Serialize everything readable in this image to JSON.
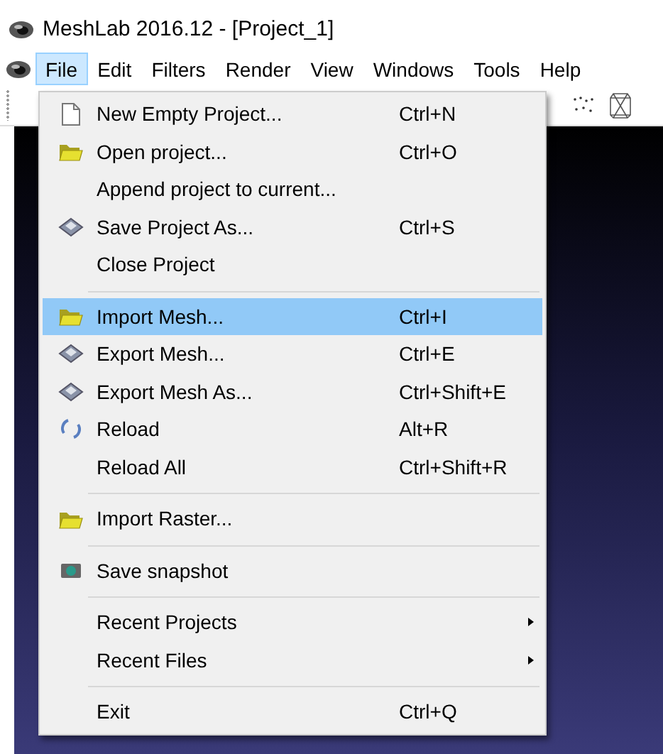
{
  "window": {
    "title": "MeshLab 2016.12 - [Project_1]"
  },
  "menubar": [
    {
      "label": "File",
      "selected": true
    },
    {
      "label": "Edit",
      "selected": false
    },
    {
      "label": "Filters",
      "selected": false
    },
    {
      "label": "Render",
      "selected": false
    },
    {
      "label": "View",
      "selected": false
    },
    {
      "label": "Windows",
      "selected": false
    },
    {
      "label": "Tools",
      "selected": false
    },
    {
      "label": "Help",
      "selected": false
    }
  ],
  "file_menu": [
    {
      "kind": "page",
      "label": "New Empty Project...",
      "shortcut": "Ctrl+N",
      "selected": false
    },
    {
      "kind": "folder",
      "label": "Open project...",
      "shortcut": "Ctrl+O",
      "selected": false
    },
    {
      "kind": "plain",
      "label": "Append project to current...",
      "selected": false
    },
    {
      "kind": "disk",
      "label": "Save Project As...",
      "shortcut": "Ctrl+S",
      "selected": false
    },
    {
      "kind": "plain",
      "label": "Close Project",
      "selected": false
    },
    {
      "kind": "separator"
    },
    {
      "kind": "folder",
      "label": "Import Mesh...",
      "shortcut": "Ctrl+I",
      "selected": true
    },
    {
      "kind": "disk",
      "label": "Export Mesh...",
      "shortcut": "Ctrl+E",
      "selected": false
    },
    {
      "kind": "disk",
      "label": "Export Mesh As...",
      "shortcut": "Ctrl+Shift+E",
      "selected": false
    },
    {
      "kind": "reload",
      "label": "Reload",
      "shortcut": "Alt+R",
      "selected": false
    },
    {
      "kind": "plain",
      "label": "Reload All",
      "shortcut": "Ctrl+Shift+R",
      "selected": false
    },
    {
      "kind": "separator"
    },
    {
      "kind": "folder",
      "label": "Import Raster...",
      "selected": false
    },
    {
      "kind": "separator"
    },
    {
      "kind": "camera",
      "label": "Save snapshot",
      "selected": false
    },
    {
      "kind": "separator"
    },
    {
      "kind": "plain",
      "label": "Recent Projects",
      "submenu": true,
      "selected": false
    },
    {
      "kind": "plain",
      "label": "Recent Files",
      "submenu": true,
      "selected": false
    },
    {
      "kind": "separator"
    },
    {
      "kind": "plain",
      "label": "Exit",
      "shortcut": "Ctrl+Q",
      "selected": false
    }
  ]
}
